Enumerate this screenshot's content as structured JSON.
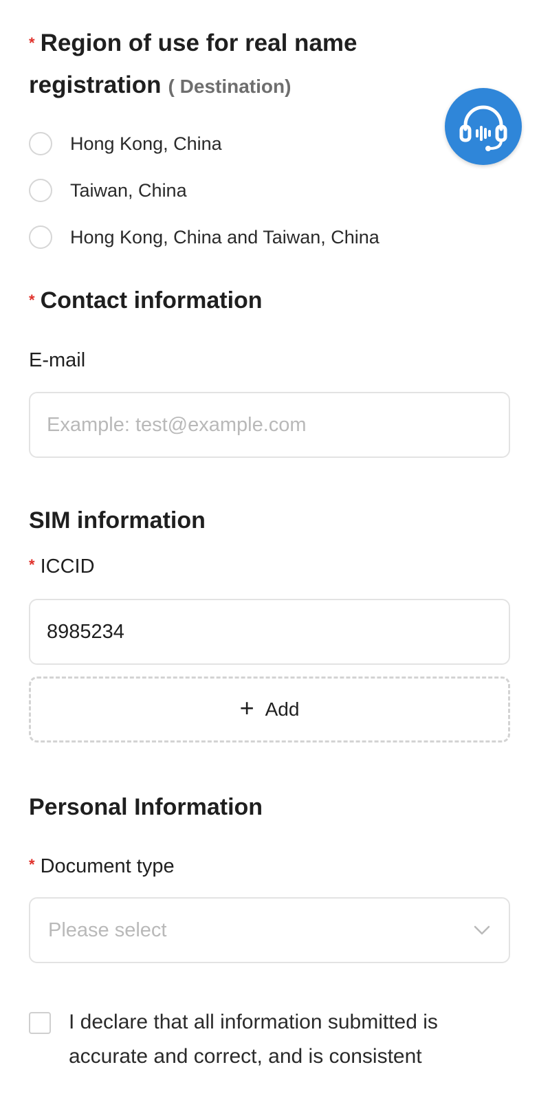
{
  "region": {
    "required_mark": "*",
    "title": "Region of use for real name registration",
    "destination_note": "( Destination)",
    "options": [
      {
        "label": "Hong Kong, China"
      },
      {
        "label": "Taiwan, China"
      },
      {
        "label": "Hong Kong, China and Taiwan, China"
      }
    ]
  },
  "contact": {
    "required_mark": "*",
    "title": "Contact information",
    "email_label": "E-mail",
    "email_placeholder": "Example: test@example.com",
    "email_value": ""
  },
  "sim": {
    "title": "SIM information",
    "required_mark": "*",
    "iccid_label": "ICCID",
    "iccid_value": "8985234",
    "add_icon": "+",
    "add_label": "Add"
  },
  "personal": {
    "title": "Personal Information",
    "required_mark": "*",
    "document_type_label": "Document type",
    "document_type_placeholder": "Please select"
  },
  "declaration": {
    "text": "I declare that all information submitted is accurate and correct, and is consistent"
  },
  "colors": {
    "required": "#e0312b",
    "support_button": "#2f86d9"
  },
  "icons": {
    "support": "headset-icon",
    "dropdown": "chevron-down-icon"
  }
}
